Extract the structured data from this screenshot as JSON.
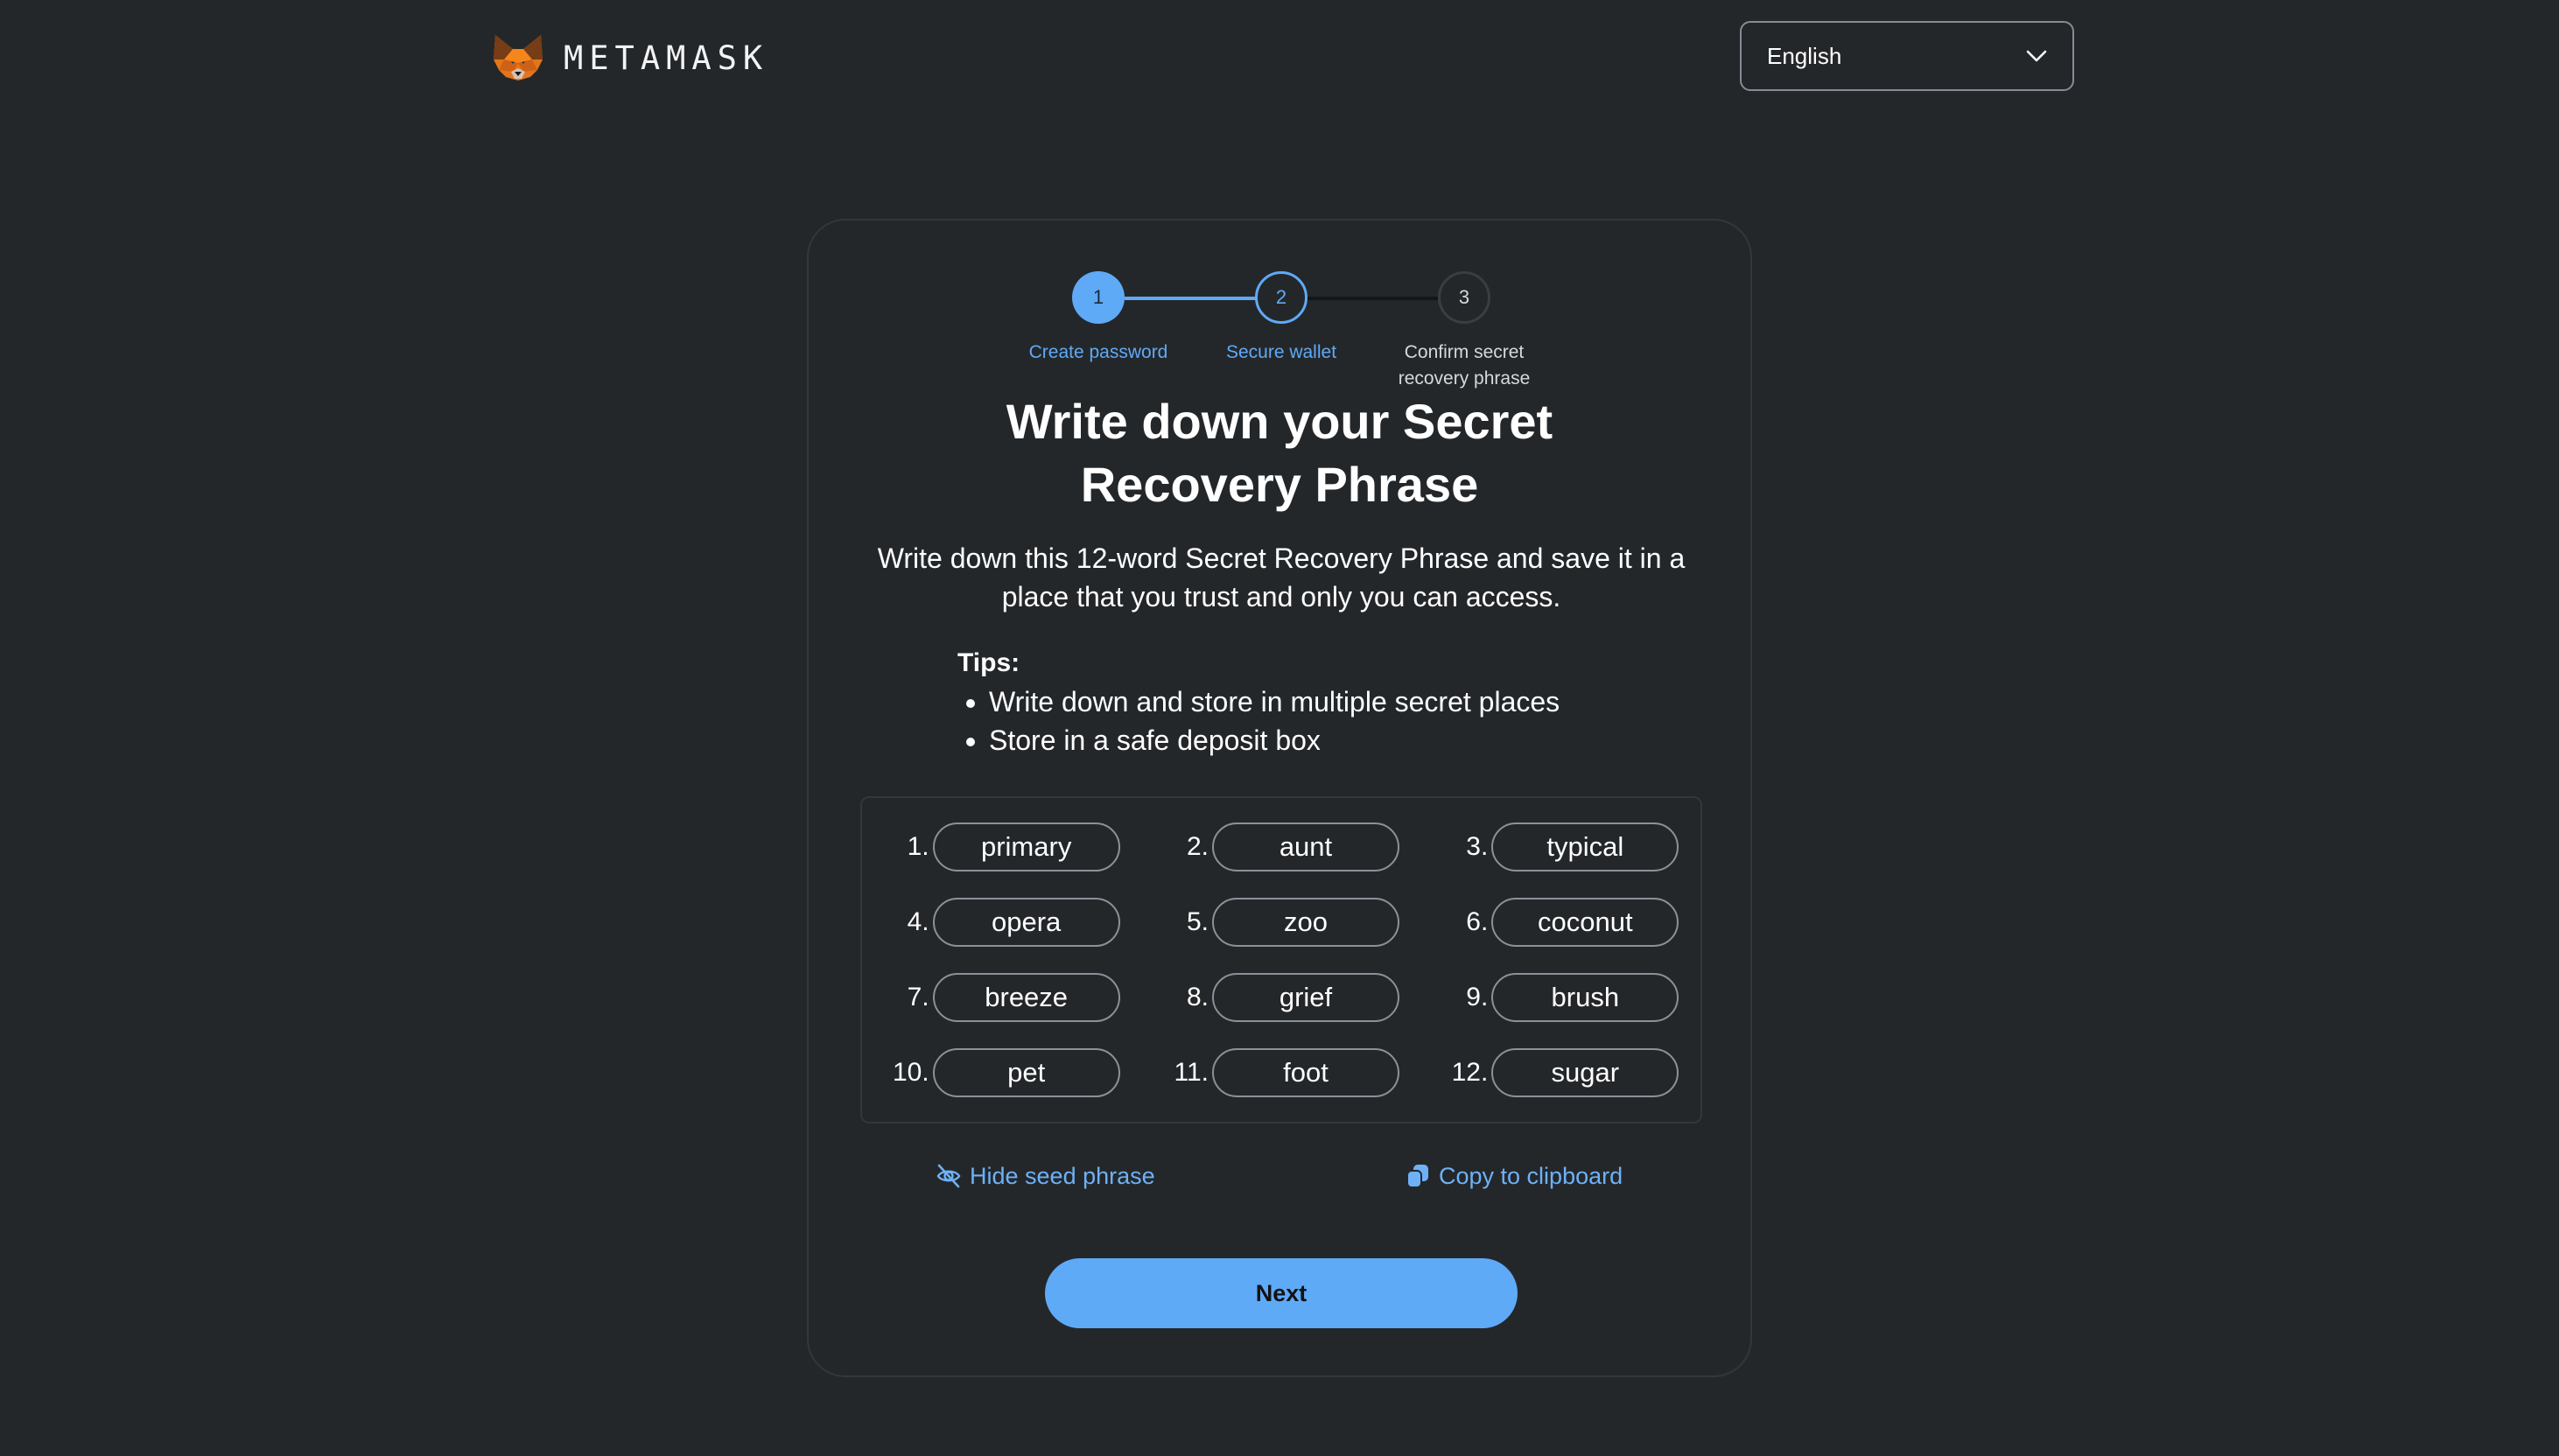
{
  "header": {
    "brand": "METAMASK",
    "language_select": {
      "selected": "English"
    }
  },
  "stepper": {
    "steps": [
      {
        "number": "1",
        "label": "Create password",
        "state": "complete"
      },
      {
        "number": "2",
        "label": "Secure wallet",
        "state": "active"
      },
      {
        "number": "3",
        "label": "Confirm secret recovery phrase",
        "state": "pending"
      }
    ]
  },
  "main": {
    "title": "Write down your Secret Recovery Phrase",
    "description": "Write down this 12-word Secret Recovery Phrase and save it in a place that you trust and only you can access.",
    "tips": {
      "title": "Tips:",
      "items": [
        "Write down and store in multiple secret places",
        "Store in a safe deposit box"
      ]
    },
    "seed_words": [
      {
        "index": "1.",
        "word": "primary"
      },
      {
        "index": "2.",
        "word": "aunt"
      },
      {
        "index": "3.",
        "word": "typical"
      },
      {
        "index": "4.",
        "word": "opera"
      },
      {
        "index": "5.",
        "word": "zoo"
      },
      {
        "index": "6.",
        "word": "coconut"
      },
      {
        "index": "7.",
        "word": "breeze"
      },
      {
        "index": "8.",
        "word": "grief"
      },
      {
        "index": "9.",
        "word": "brush"
      },
      {
        "index": "10.",
        "word": "pet"
      },
      {
        "index": "11.",
        "word": "foot"
      },
      {
        "index": "12.",
        "word": "sugar"
      }
    ],
    "hide_seed_label": "Hide seed phrase",
    "copy_label": "Copy to clipboard",
    "next_label": "Next"
  },
  "colors": {
    "accent": "#5faaf7",
    "link": "#6eb1f7",
    "background": "#24272a",
    "pending": "#3a3d41"
  },
  "icons": {
    "logo": "metamask-fox-icon",
    "language_chevron": "chevron-down-icon",
    "hide": "eye-slash-icon",
    "copy": "copy-icon"
  }
}
